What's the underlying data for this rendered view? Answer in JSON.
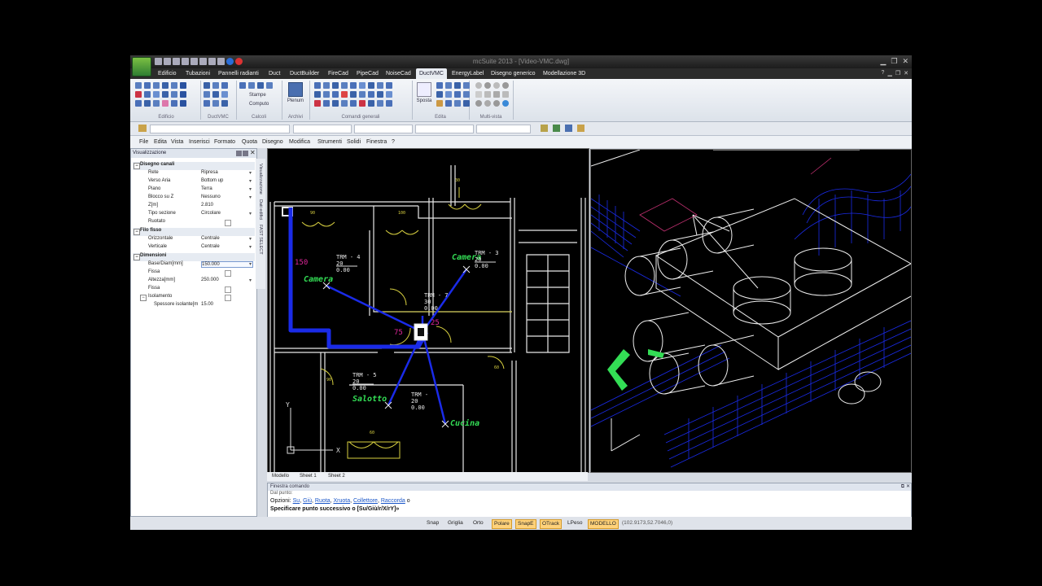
{
  "window": {
    "title": "mcSuite 2013 - [Video-VMC.dwg]"
  },
  "ribbon_tabs": [
    "Edificio",
    "Tubazioni",
    "Pannelli radianti",
    "Duct",
    "DuctBuilder",
    "FireCad",
    "PipeCad",
    "NoiseCad",
    "DuctVMC",
    "EnergyLabel",
    "Disegno generico",
    "Modellazione 3D"
  ],
  "active_tab": "DuctVMC",
  "ribbon_groups": [
    "Edificio",
    "DuctVMC",
    "Calcoli",
    "Archivi",
    "Comandi generali",
    "Edita",
    "Multi-vista"
  ],
  "ribbon_buttons": {
    "stampe": "Stampe",
    "computo": "Computo",
    "plenum": "Plenum",
    "sposta": "Sposta"
  },
  "menu": [
    "File",
    "Edita",
    "Vista",
    "Inserisci",
    "Formato",
    "Quota",
    "Disegno",
    "Modifica",
    "Strumenti",
    "Solidi",
    "Finestra",
    "?"
  ],
  "panel": {
    "title": "Visualizzazione",
    "sections": {
      "disegno": "Disegno canali",
      "filo": "Filo fisso",
      "dimensioni": "Dimensioni"
    },
    "props": {
      "rete": {
        "k": "Rete",
        "v": "Ripresa"
      },
      "verso": {
        "k": "Verso Aria",
        "v": "Bottom up"
      },
      "piano": {
        "k": "Piano",
        "v": "Terra"
      },
      "blocco": {
        "k": "Blocco su Z",
        "v": "Nessuno"
      },
      "z": {
        "k": "Z[m]",
        "v": "2.810"
      },
      "tipo": {
        "k": "Tipo sezione",
        "v": "Circolare"
      },
      "ruotato": {
        "k": "Ruotato",
        "v": ""
      },
      "orizz": {
        "k": "Orizzontale",
        "v": "Centrale"
      },
      "vert": {
        "k": "Verticale",
        "v": "Centrale"
      },
      "base": {
        "k": "Base/Diam[mm]",
        "v": "150.000"
      },
      "fissa1": {
        "k": "Fissa",
        "v": ""
      },
      "altezza": {
        "k": "Altezza[mm]",
        "v": "250.000"
      },
      "fissa2": {
        "k": "Fissa",
        "v": ""
      },
      "isol": {
        "k": "Isolamento",
        "v": ""
      },
      "spess": {
        "k": "Spessore isolante[m",
        "v": "15.00"
      }
    }
  },
  "side_tabs": [
    "Visualizzazione",
    "Dati edifici",
    "FAST SELECT"
  ],
  "drawing": {
    "rooms": [
      "Camera",
      "Camera",
      "Salotto",
      "Cucina"
    ],
    "terminals": [
      {
        "name": "TRM - 4",
        "a": "20",
        "b": "0.00"
      },
      {
        "name": "TRM - 3",
        "a": "20",
        "b": "0.00"
      },
      {
        "name": "TRM - 7",
        "a": "30",
        "b": "0.00"
      },
      {
        "name": "TRM - 5",
        "a": "20",
        "b": "0.00"
      },
      {
        "name": "TRM -",
        "a": "20",
        "b": "0.00"
      }
    ],
    "duct_label": "150",
    "dims": [
      "30",
      "90",
      "75",
      "100",
      "60",
      "25"
    ],
    "axis_y": "Y",
    "axis_x": "X"
  },
  "sheets": [
    "Modello",
    "Sheet 1",
    "Sheet 2"
  ],
  "command": {
    "title": "Finestra comando",
    "line1": "Dal punto:",
    "opts_label": "Opzioni:",
    "opts": [
      "Su",
      "Giù",
      "Ruota",
      "Xruota",
      "Collettore",
      "Raccorda"
    ],
    "opts_tail": "o",
    "line3": "Specificare punto successivo o [Su/Giù/r/X/rY]»"
  },
  "status": {
    "buttons": [
      "Snap",
      "Griglia",
      "Orto",
      "Polare",
      "SnapE",
      "OTrack",
      "LPeso",
      "MODELLO"
    ],
    "active": [
      "Polare",
      "SnapE",
      "OTrack",
      "MODELLO"
    ],
    "coords": "(102.9173,52.7046,0)"
  },
  "colors": {
    "duct_blue": "#1a2be8",
    "wall_white": "#f0f0f0",
    "door_yellow": "#d8d040",
    "room_green": "#33dd55",
    "accent_orange": "#ffd27a"
  }
}
